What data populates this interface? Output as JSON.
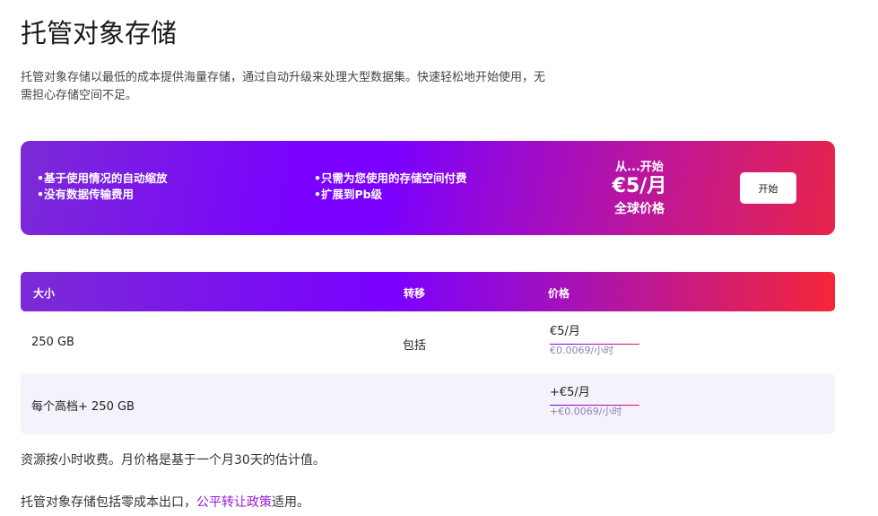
{
  "title": "托管对象存储",
  "description": "托管对象存储以最低的成本提供海量存储，通过自动升级来处理大型数据集。快速轻松地开始使用，无需担心存储空间不足。",
  "banner": {
    "features_left": [
      "•基于使用情况的自动缩放",
      "•没有数据传输费用"
    ],
    "features_right": [
      "•只需为您使用的存储空间付费",
      "•扩展到Pb级"
    ],
    "from": "从...开始",
    "price": "€5/月",
    "scope": "全球价格",
    "button": "开始"
  },
  "table": {
    "headers": [
      "大小",
      "转移",
      "价格"
    ],
    "rows": [
      {
        "size": "250 GB",
        "transfer": "包括",
        "price": "€5/月",
        "hourly": "€0.0069/小时"
      },
      {
        "size": "每个高档+ 250 GB",
        "transfer": "",
        "price": "+€5/月",
        "hourly": "+€0.0069/小时"
      }
    ]
  },
  "note1": "资源按小时收费。月价格是基于一个月30天的估计值。",
  "note2_before": "托管对象存储包括零成本出口，",
  "note2_link": "公平转让政策",
  "note2_after": "适用。"
}
